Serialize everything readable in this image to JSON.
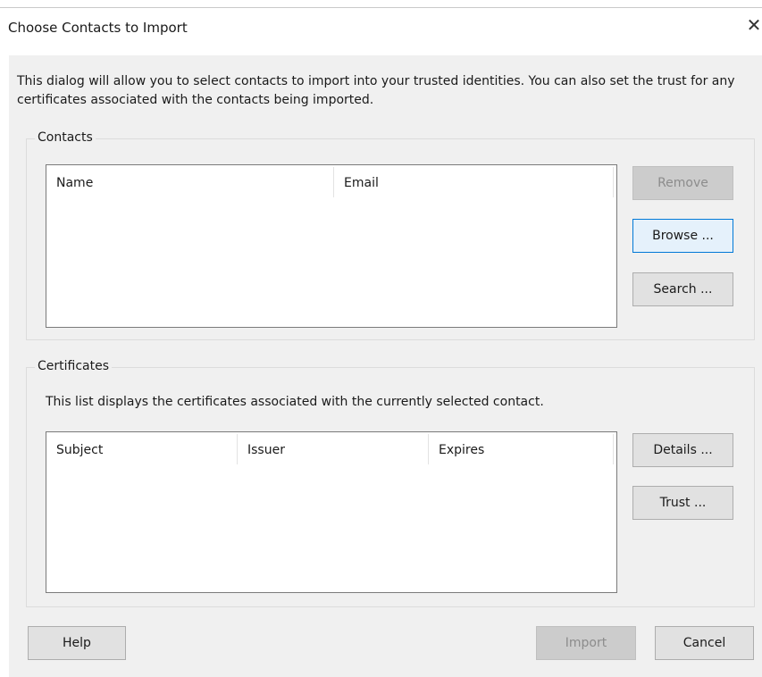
{
  "dialog": {
    "title": "Choose Contacts to Import",
    "close_label": "✕",
    "intro": "This dialog will allow you to select contacts to import into your trusted identities. You can also set the trust for any certificates associated with the contacts being imported."
  },
  "contacts": {
    "legend": "Contacts",
    "columns": [
      "Name",
      "Email"
    ],
    "rows": [],
    "buttons": {
      "remove": "Remove",
      "browse": "Browse ...",
      "search": "Search ..."
    }
  },
  "certificates": {
    "legend": "Certificates",
    "description": "This list displays the certificates associated with the currently selected contact.",
    "columns": [
      "Subject",
      "Issuer",
      "Expires"
    ],
    "rows": [],
    "buttons": {
      "details": "Details ...",
      "trust": "Trust ..."
    }
  },
  "footer": {
    "help": "Help",
    "import": "Import",
    "cancel": "Cancel"
  },
  "colors": {
    "dialog_background": "#f0f0f0",
    "button_background": "#e1e1e1",
    "disabled_button": "#cccccc",
    "focus_border": "#0078d7"
  },
  "icons": {
    "close": "close-icon"
  }
}
